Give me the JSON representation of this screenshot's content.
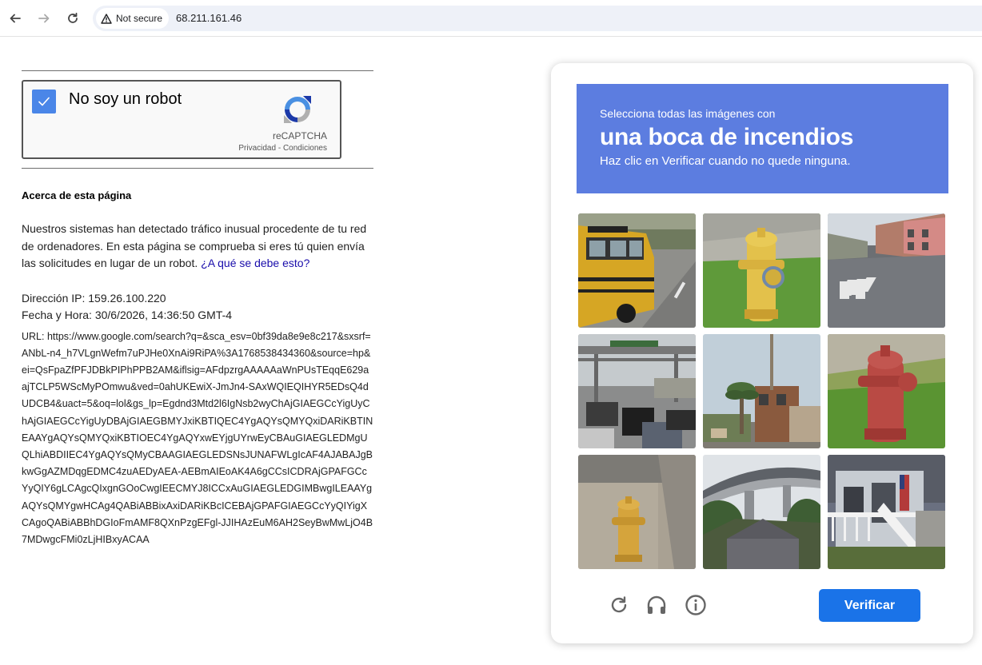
{
  "browser": {
    "security_label": "Not secure",
    "url": "68.211.161.46"
  },
  "recaptcha": {
    "checkbox_label": "No soy un robot",
    "brand": "reCAPTCHA",
    "privacy": "Privacidad",
    "separator": " - ",
    "terms": "Condiciones",
    "checked": true
  },
  "page": {
    "about_title": "Acerca de esta página",
    "paragraph": "Nuestros sistemas han detectado tráfico inusual procedente de tu red de ordenadores. En esta página se comprueba si eres tú quien envía las solicitudes en lugar de un robot. ",
    "why_link": "¿A qué se debe esto?",
    "ip_line": "Dirección IP: 159.26.100.220",
    "datetime_line": "Fecha y Hora: 30/6/2026, 14:36:50 GMT-4",
    "url_line": "URL: https://www.google.com/search?q=&sca_esv=0bf39da8e9e8c217&sxsrf=ANbL-n4_h7VLgnWefm7uPJHe0XnAi9RiPA%3A1768538434360&source=hp&ei=QsFpaZfPFJDBkPIPhPPB2AM&iflsig=AFdpzrgAAAAAaWnPUsTEqqE629aajTCLP5WScMyPOmwu&ved=0ahUKEwiX-JmJn4-SAxWQIEQIHYR5EDsQ4dUDCB4&uact=5&oq=lol&gs_lp=Egdnd3Mtd2l6IgNsb2wyChAjGIAEGCcYigUyChAjGIAEGCcYigUyDBAjGIAEGBMYJxiKBTIQEC4YgAQYsQMYQxiDARiKBTINEAAYgAQYsQMYQxiKBTIOEC4YgAQYxwEYjgUYrwEyCBAuGIAEGLEDMgUQLhiABDIIEC4YgAQYsQMyCBAAGIAEGLEDSNsJUNAFWLgIcAF4AJABAJgBkwGgAZMDqgEDMC4zuAEDyAEA-AEBmAIEoAK4A6gCCsICDRAjGPAFGCcYyQIY6gLCAgcQIxgnGOoCwgIEECMYJ8ICCxAuGIAEGLEDGIMBwgILEAAYgAQYsQMYgwHCAg4QABiABBixAxiDARiKBcICEBAjGPAFGIAEGCcYyQIYigXCAgoQABiABBhDGIoFmAMF8QXnPzgEFgl-JJIHAzEuM6AH2SeyBwMwLjO4B7MDwgcFMi0zLjHIBxyACAA"
  },
  "challenge": {
    "instruction_line1": "Selecciona todas las imágenes con",
    "target_object": "una boca de incendios",
    "instruction_line3": "Haz clic en Verificar cuando no quede ninguna.",
    "verify_label": "Verificar",
    "tiles": [
      {
        "id": 1,
        "subject": "yellow school bus"
      },
      {
        "id": 2,
        "subject": "yellow fire hydrant on grass"
      },
      {
        "id": 3,
        "subject": "street with crosswalk and houses"
      },
      {
        "id": 4,
        "subject": "highway with traffic"
      },
      {
        "id": 5,
        "subject": "palm tree and building"
      },
      {
        "id": 6,
        "subject": "red fire hydrant on grass"
      },
      {
        "id": 7,
        "subject": "yellow fire hydrant on sidewalk"
      },
      {
        "id": 8,
        "subject": "highway overpass bridge"
      },
      {
        "id": 9,
        "subject": "white house porch with flag"
      }
    ]
  },
  "colors": {
    "banner": "#5c7de0",
    "verify_button": "#1a73e8",
    "checkbox": "#4a86e8",
    "link": "#1a0dab"
  }
}
